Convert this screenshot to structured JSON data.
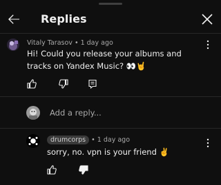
{
  "header": {
    "title": "Replies"
  },
  "original_comment": {
    "author": "Vitaly Tarasov",
    "separator": " • ",
    "time": "1 day ago",
    "text": "Hi! Could you release your albums and tracks on Yandex Music? 👀🤘"
  },
  "add_reply": {
    "placeholder": "Add a reply..."
  },
  "reply": {
    "author": "drumcorps",
    "separator": " • ",
    "time": "1 day ago",
    "text": "sorry, no. vpn is your friend ✌️"
  },
  "colors": {
    "background": "#0f0f0f",
    "divider": "#272727",
    "secondary_text": "#aaaaaa",
    "primary_text": "#f1f1f1",
    "author_chip": "#3a3a3a"
  }
}
